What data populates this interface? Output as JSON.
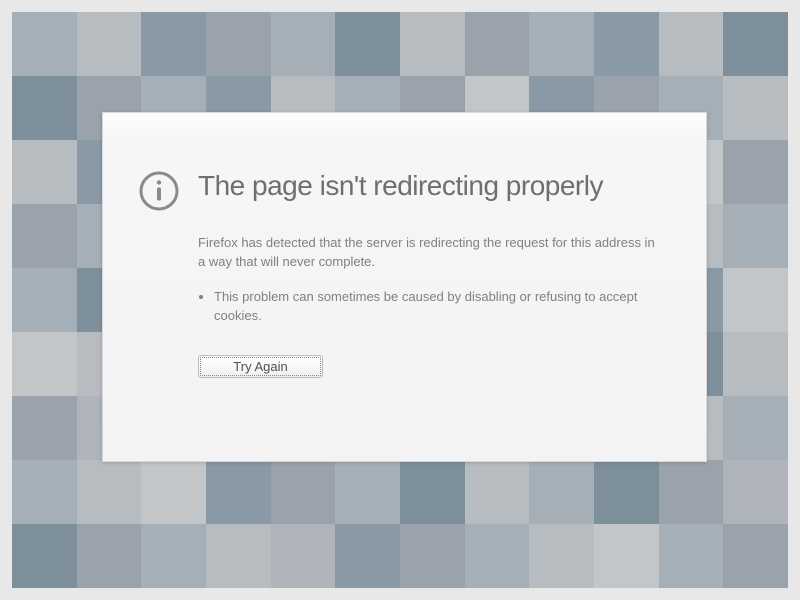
{
  "error": {
    "title": "The page isn't redirecting properly",
    "message": "Firefox has detected that the server is redirecting the request for this address in a way that will never complete.",
    "bullet1": "This problem can sometimes be caused by disabling or refusing to accept cookies.",
    "try_again_label": "Try Again"
  }
}
